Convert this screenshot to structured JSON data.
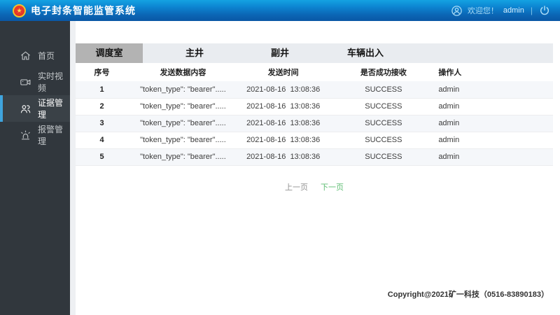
{
  "header": {
    "title": "电子封条智能监管系统",
    "welcome": "欢迎您！",
    "username": "admin",
    "divider": "|"
  },
  "sidebar": {
    "items": [
      {
        "label": "首页",
        "icon": "home-icon"
      },
      {
        "label": "实时视频",
        "icon": "video-camera-icon"
      },
      {
        "label": "证据管理",
        "icon": "users-icon"
      },
      {
        "label": "报警管理",
        "icon": "alarm-icon"
      }
    ]
  },
  "tabs": [
    {
      "label": "调度室",
      "active": true
    },
    {
      "label": "主井",
      "active": false
    },
    {
      "label": "副井",
      "active": false
    },
    {
      "label": "车辆出入",
      "active": false
    }
  ],
  "table": {
    "columns": [
      "序号",
      "发送数据内容",
      "发送时间",
      "是否成功接收",
      "操作人"
    ],
    "rows": [
      {
        "no": "1",
        "content": "\"token_type\": \"bearer\".....",
        "time": "2021-08-16  13:08:36",
        "status": "SUCCESS",
        "operator": "admin"
      },
      {
        "no": "2",
        "content": "\"token_type\": \"bearer\".....",
        "time": "2021-08-16  13:08:36",
        "status": "SUCCESS",
        "operator": "admin"
      },
      {
        "no": "3",
        "content": "\"token_type\": \"bearer\".....",
        "time": "2021-08-16  13:08:36",
        "status": "SUCCESS",
        "operator": "admin"
      },
      {
        "no": "4",
        "content": "\"token_type\": \"bearer\".....",
        "time": "2021-08-16  13:08:36",
        "status": "SUCCESS",
        "operator": "admin"
      },
      {
        "no": "5",
        "content": "\"token_type\": \"bearer\".....",
        "time": "2021-08-16  13:08:36",
        "status": "SUCCESS",
        "operator": "admin"
      }
    ]
  },
  "pagination": {
    "prev": "上一页",
    "next": "下一页"
  },
  "footer": {
    "copyright": "Copyright@2021矿一科技（0516-83890183）"
  },
  "colors": {
    "header_gradient_top": "#14a2e2",
    "header_gradient_bottom": "#0a57a5",
    "sidebar_bg": "#31373d",
    "active_indicator": "#3fa4de",
    "tabbar_bg": "#e9ecf0",
    "tab_active_bg": "#b3b3b3",
    "row_stripe": "#f5f7fa",
    "next_link_green": "#5dbd72",
    "success_text": "#3d3d3d"
  }
}
